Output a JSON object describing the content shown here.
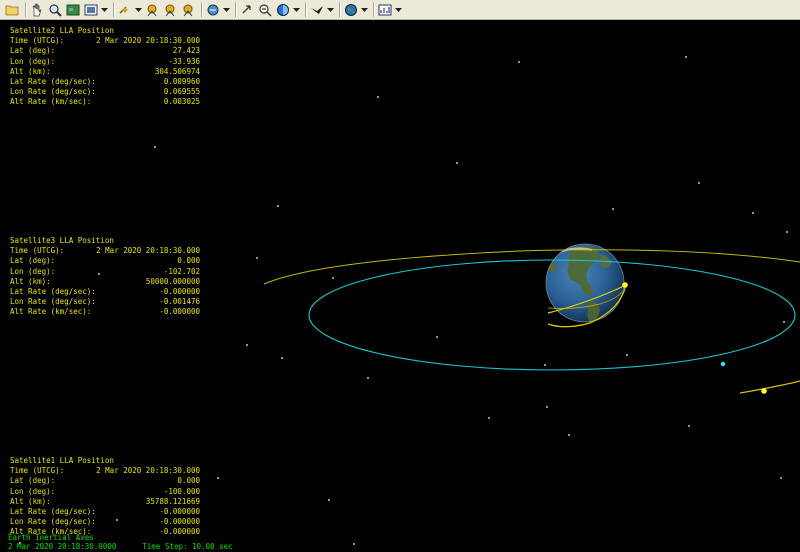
{
  "toolbar": {
    "icons": [
      "folder-icon",
      "hand-pan-icon",
      "zoom-icon",
      "map-view-icon",
      "image-view-icon",
      "dropdown",
      "satellite-icon",
      "dropdown",
      "globe-group-icon",
      "globe-group-icon",
      "globe-group-icon",
      "dropdown",
      "camera-icon",
      "dropdown",
      "rotate-icon",
      "zoom-out-icon",
      "target-icon",
      "dropdown",
      "bird-icon",
      "dropdown",
      "globe-icon",
      "dropdown",
      "chart-icon",
      "dropdown"
    ]
  },
  "panels": [
    {
      "title": "Satellite2 LLA Position",
      "rows": [
        {
          "label": "Time (UTCG):",
          "value": "2 Mar 2020 20:18:30.000"
        },
        {
          "label": "Lat (deg):",
          "value": "27.423"
        },
        {
          "label": "Lon (deg):",
          "value": "-33.936"
        },
        {
          "label": "Alt (km):",
          "value": "304.506974"
        },
        {
          "label": "Lat Rate (deg/sec):",
          "value": "0.009960"
        },
        {
          "label": "Lon Rate (deg/sec):",
          "value": "0.069555"
        },
        {
          "label": "Alt Rate (km/sec):",
          "value": "0.003025"
        }
      ]
    },
    {
      "title": "Satellite3 LLA Position",
      "rows": [
        {
          "label": "Time (UTCG):",
          "value": "2 Mar 2020 20:18:30.000"
        },
        {
          "label": "Lat (deg):",
          "value": "0.000"
        },
        {
          "label": "Lon (deg):",
          "value": "-102.702"
        },
        {
          "label": "Alt (km):",
          "value": "50000.000000"
        },
        {
          "label": "Lat Rate (deg/sec):",
          "value": "-0.000000"
        },
        {
          "label": "Lon Rate (deg/sec):",
          "value": "-0.001476"
        },
        {
          "label": "Alt Rate (km/sec):",
          "value": "-0.000000"
        }
      ]
    },
    {
      "title": "Satellite1 LLA Position",
      "rows": [
        {
          "label": "Time (UTCG):",
          "value": "2 Mar 2020 20:18:30.000"
        },
        {
          "label": "Lat (deg):",
          "value": "0.000"
        },
        {
          "label": "Lon (deg):",
          "value": "-100.000"
        },
        {
          "label": "Alt (km):",
          "value": "35788.121669"
        },
        {
          "label": "Lat Rate (deg/sec):",
          "value": "-0.000000"
        },
        {
          "label": "Lon Rate (deg/sec):",
          "value": "-0.000000"
        },
        {
          "label": "Alt Rate (km/sec):",
          "value": "-0.000000"
        }
      ]
    }
  ],
  "status": {
    "frame": "Earth Inertial Axes",
    "time": "2 Mar 2020 20:18:30.0000",
    "step": "Time Step: 10.00 sec"
  },
  "colors": {
    "text": "#e8e400",
    "status": "#00e000",
    "orbit_yellow": "#d8c800",
    "orbit_cyan": "#18c8d8",
    "background": "#000000"
  }
}
